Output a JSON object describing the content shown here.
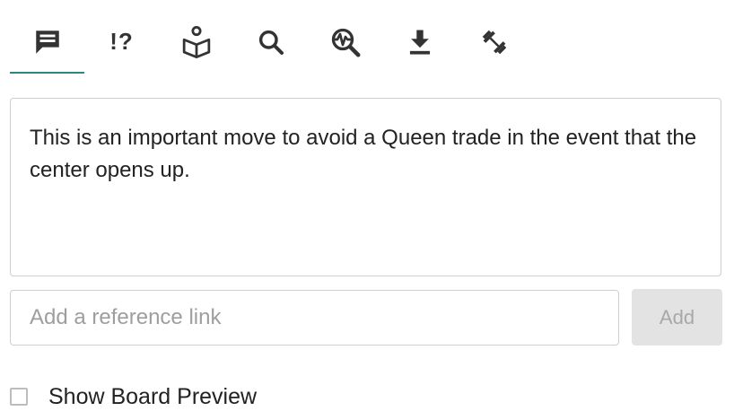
{
  "tabs": [
    {
      "id": "comments",
      "icon": "comment-icon",
      "active": true
    },
    {
      "id": "annotations",
      "icon": "move-annotation-icon",
      "text": "!?"
    },
    {
      "id": "opening",
      "icon": "book-reader-icon"
    },
    {
      "id": "search",
      "icon": "search-icon"
    },
    {
      "id": "analysis",
      "icon": "engine-analysis-icon"
    },
    {
      "id": "download",
      "icon": "download-icon"
    },
    {
      "id": "training",
      "icon": "dumbbell-icon"
    }
  ],
  "colors": {
    "accent": "#2a8a7c",
    "add_button_bg": "#e3e3e3"
  },
  "comment": {
    "text": "This is an important move to avoid a Queen trade in the event that the center opens up."
  },
  "reference": {
    "placeholder": "Add a reference link",
    "value": "",
    "add_label": "Add"
  },
  "preview": {
    "label": "Show Board Preview",
    "checked": false
  }
}
